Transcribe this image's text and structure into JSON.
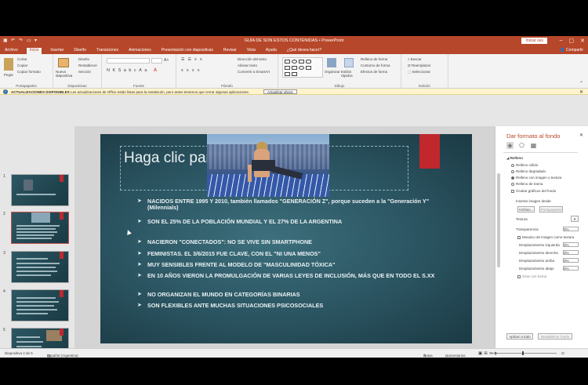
{
  "window": {
    "title": "GUÍA DE SON ESTOS CONTENIDAS • PowerPoint",
    "sign_in": "Iniciar ses",
    "share": "Compartir"
  },
  "tabs": [
    "Archivo",
    "Inicio",
    "Insertar",
    "Diseño",
    "Transiciones",
    "Animaciones",
    "Presentación con diapositivas",
    "Revisar",
    "Vista",
    "Ayuda",
    "¿Qué desea hacer?"
  ],
  "ribbon": {
    "groups": {
      "clipboard": "Portapapeles",
      "slides": "Diapositivas",
      "font": "Fuente",
      "paragraph": "Párrafo",
      "drawing": "Dibujo",
      "editing": "Edición"
    },
    "clipboard_items": [
      "Cortar",
      "Copiar",
      "Copiar formato"
    ],
    "paste": "Pegar",
    "new_slide": "Nueva diapositiva",
    "slide_items": [
      "Diseño",
      "Restablecer",
      "Sección"
    ],
    "paragraph_items": [
      "Dirección del texto",
      "Alinear texto",
      "Convertir a SmartArt"
    ],
    "arrange": "Organizar",
    "quick_styles": "Estilos rápidos",
    "drawing_items": [
      "Relleno de forma",
      "Contorno de forma",
      "Efectos de forma"
    ],
    "editing_items": [
      "Buscar",
      "Reemplazar",
      "Seleccionar"
    ]
  },
  "infobar": {
    "title": "ACTUALIZACIONES DISPONIBLES",
    "message": "Las actualizaciones de Office están listas para la instalación, pero antes tenemos que cerrar algunas aplicaciones.",
    "button": "Actualizar ahora"
  },
  "thumbnails": [
    {
      "number": "1"
    },
    {
      "number": "2"
    },
    {
      "number": "3"
    },
    {
      "number": "4"
    },
    {
      "number": "5"
    }
  ],
  "slide": {
    "title": "Haga clic para agregar título",
    "bullets": [
      "NACIDOS ENTRE 1995 Y 2010, también llamados \"GENERACIÓN Z\", porque suceden a la \"Generación Y\" (Milennials)",
      "SON EL 25% DE LA POBLACIÓN MUNDIAL Y EL 27% DE LA ARGENTINA",
      "NACIERON \"CONECTADOS\": NO SE VIVE SIN SMARTPHONE",
      "FEMINISTAS. EL 3/6/2015 FUE CLAVE, CON EL \"NI UNA MENOS\"",
      "MUY SENSIBLES FRENTE AL MODELO DE \"MASCULINIDAD TÓXICA\"",
      "EN 10 AÑOS VIERON LA PROMULGACIÓN DE VARIAS LEYES DE INCLUSIÓN, MÁS QUE EN TODO EL S.XX",
      "NO ORGANIZAN EL MUNDO EN CATEGORÍAS BINARIAS",
      "SON FLEXIBLES ANTE MUCHAS SITUACIONES PSICOSOCIALES"
    ],
    "bullet_marker": "➤"
  },
  "format_pane": {
    "title": "Dar formato al fondo",
    "section": "Relleno",
    "options": [
      "Relleno sólido",
      "Relleno degradado",
      "Relleno con imagen o textura",
      "Relleno de trama",
      "Ocultar gráficos del fondo"
    ],
    "insert_from": "Insertar imagen desde",
    "file_button": "Archivo...",
    "clipboard_button": "Portapapeles",
    "texture_label": "Textura",
    "transparency_label": "Transparencia",
    "transparency_value": "0%",
    "tile_label": "Mosaico de imagen como textura",
    "offset_labels": [
      "Desplazamiento izquierda",
      "Desplazamiento derecha",
      "Desplazamiento arriba",
      "Desplazamiento abajo"
    ],
    "offset_values": [
      "0%",
      "0%",
      "0%",
      "0%"
    ],
    "rotate_label": "Girar con forma",
    "apply_all": "Aplicar a todo",
    "reset": "Restablecer fondo"
  },
  "status": {
    "slide_info": "Diapositiva 2 de 5",
    "language": "Español (Argentina)",
    "notes": "Notas",
    "comments": "Comentarios"
  },
  "colors": {
    "accent": "#b7472a",
    "slide_bg": "#2a5360",
    "slide_red": "#c0282d"
  }
}
